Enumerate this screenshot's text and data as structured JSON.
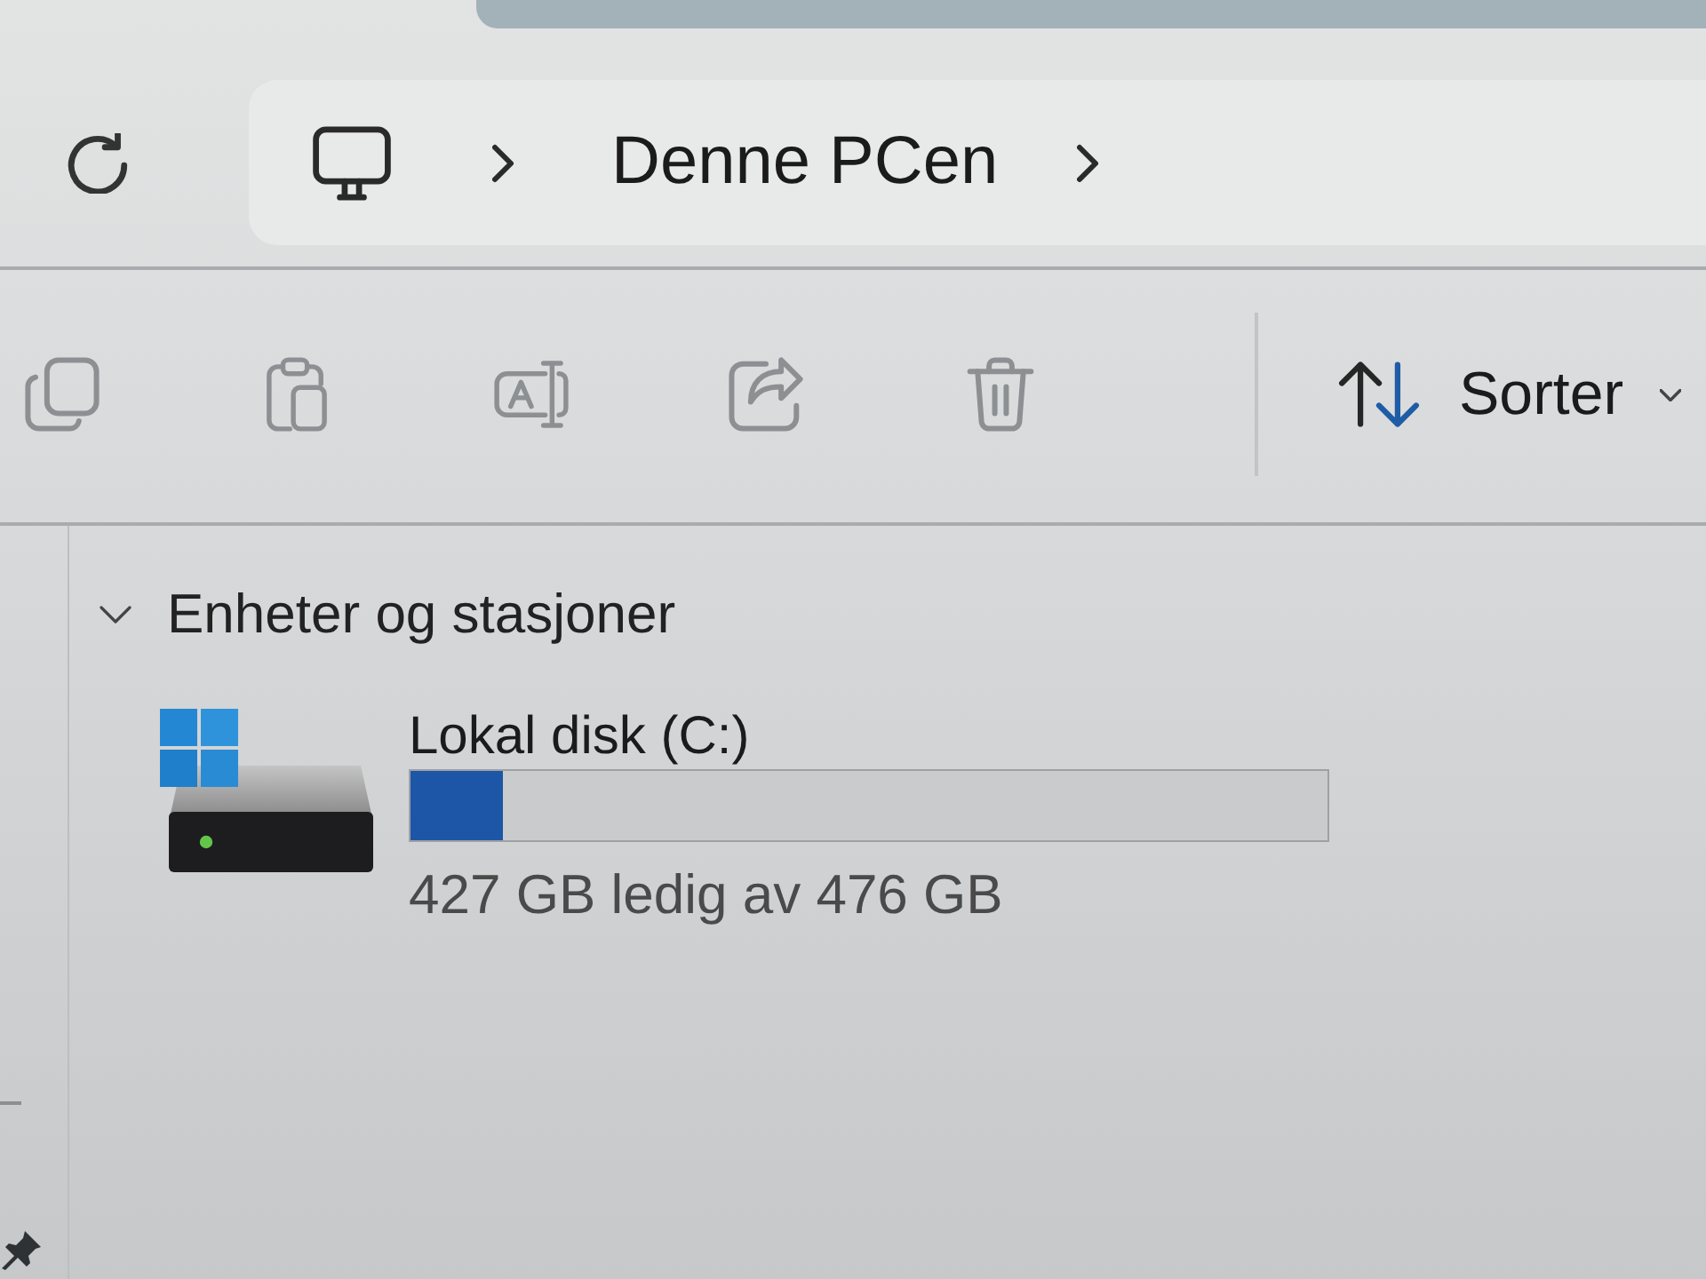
{
  "address_bar": {
    "breadcrumbs": [
      {
        "label": "Denne PCen"
      }
    ]
  },
  "toolbar": {
    "actions": [
      {
        "kind": "copy",
        "disabled": true
      },
      {
        "kind": "paste",
        "disabled": true
      },
      {
        "kind": "rename",
        "disabled": true
      },
      {
        "kind": "share",
        "disabled": true
      },
      {
        "kind": "delete",
        "disabled": true
      }
    ],
    "sort": {
      "label": "Sorter"
    }
  },
  "groups": [
    {
      "title": "Enheter og stasjoner",
      "expanded": true,
      "drives": [
        {
          "name": "Lokal disk (C:)",
          "level": 0.1,
          "free_space": "427 GB ledig av 476 GB"
        }
      ]
    }
  ]
}
